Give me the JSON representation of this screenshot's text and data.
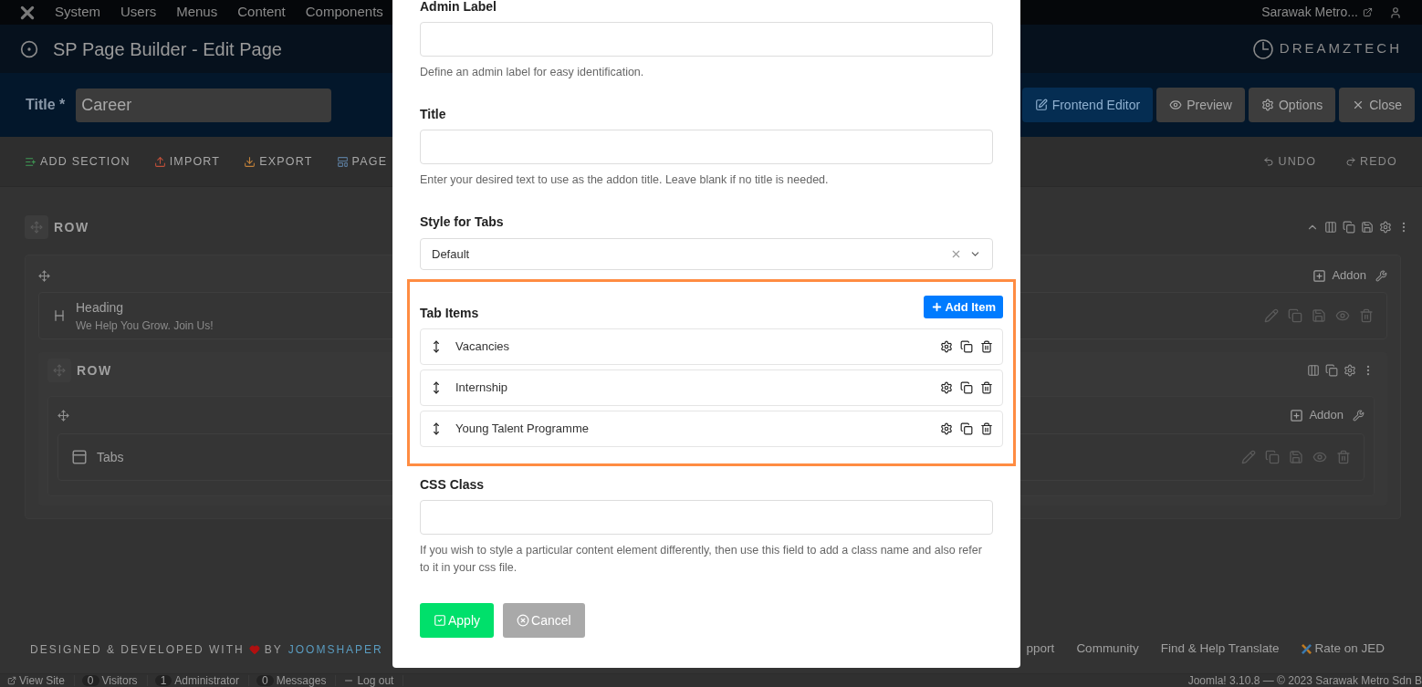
{
  "nav": {
    "menu": [
      "System",
      "Users",
      "Menus",
      "Content",
      "Components"
    ],
    "site": "Sarawak Metro..."
  },
  "header": {
    "title": "SP Page Builder - Edit Page",
    "logo": "DREAMZTECH"
  },
  "title_bar": {
    "label": "Title *",
    "value": "Career",
    "buttons": [
      {
        "kind": "primary",
        "label": "Frontend Editor"
      },
      {
        "kind": "default",
        "label": "Preview"
      },
      {
        "kind": "default",
        "label": "Options"
      },
      {
        "kind": "default",
        "label": "Close"
      }
    ]
  },
  "toolbar": {
    "left": [
      "ADD SECTION",
      "IMPORT",
      "EXPORT",
      "PAGE"
    ],
    "right": [
      {
        "label": "UNDO",
        "disabled": true
      },
      {
        "label": "REDO",
        "disabled": true
      }
    ]
  },
  "row": {
    "title": "ROW",
    "addon_label": "Addon",
    "addon": {
      "title": "Heading",
      "subtitle": "We Help You Grow. Join Us!"
    },
    "nested_row": {
      "title": "ROW",
      "addon_label": "Addon",
      "addon": {
        "title": "Tabs"
      }
    }
  },
  "modal": {
    "fields": [
      {
        "kind": "text",
        "label": "Admin Label",
        "help": "Define an admin label for easy identification."
      },
      {
        "kind": "text",
        "label": "Title",
        "help": "Enter your desired text to use as the addon title. Leave blank if no title is needed."
      },
      {
        "kind": "select",
        "label": "Style for Tabs",
        "value": "Default"
      }
    ],
    "tab_items": {
      "label": "Tab Items",
      "add_button": "Add Item",
      "items": [
        "Vacancies",
        "Internship",
        "Young Talent Programme"
      ]
    },
    "css_field": {
      "label": "CSS Class",
      "help": "If you wish to style a particular content element differently, then use this field to add a class name and also refer to it in your css file."
    },
    "buttons": [
      {
        "kind": "apply",
        "label": "Apply"
      },
      {
        "kind": "cancel",
        "label": "Cancel"
      }
    ]
  },
  "footer": {
    "credit_before": "DESIGNED & DEVELOPED WITH",
    "credit_by": "BY",
    "credit_link": "JOOMSHAPER",
    "links": [
      "pport",
      "Community",
      "Find & Help Translate",
      "Rate on JED"
    ]
  },
  "status_bar": {
    "items": [
      {
        "label": "View Site"
      },
      {
        "count": "0",
        "label": "Visitors"
      },
      {
        "count": "1",
        "label": "Administrator"
      },
      {
        "count": "0",
        "label": "Messages"
      },
      {
        "label": "Log out"
      }
    ],
    "version": "Joomla! 3.10.8 — © 2023 Sarawak Metro Sdn B"
  }
}
